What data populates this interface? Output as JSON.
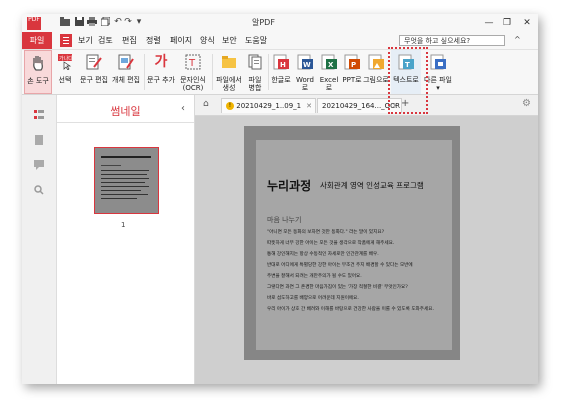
{
  "app": {
    "title": "알PDF",
    "logo_text": "PDF"
  },
  "quick_access": [
    "folder-icon",
    "save-icon",
    "print-icon",
    "copy-icon",
    "undo-icon",
    "redo-icon",
    "customize-icon"
  ],
  "window_controls": [
    "minimize-icon",
    "restore-icon",
    "close-icon"
  ],
  "menu": {
    "file": "파일",
    "items": [
      "보기",
      "검토",
      "편집",
      "정렬",
      "페이지",
      "양식",
      "보안",
      "도움말"
    ],
    "search_placeholder": "무엇을 하고 싶으세요?",
    "help": "?",
    "collapse": "^"
  },
  "ribbon": {
    "items": [
      {
        "label": "손 도구",
        "icon": "hand-icon"
      },
      {
        "label": "선택",
        "icon": "select-icon"
      },
      {
        "label": "문구 편집",
        "icon": "text-edit-icon"
      },
      {
        "label": "개체 편집",
        "icon": "object-edit-icon"
      },
      {
        "label": "문구 추가",
        "icon": "add-text-icon"
      },
      {
        "label": "문자인식",
        "label2": "(OCR)",
        "icon": "ocr-icon"
      },
      {
        "label": "파일에서",
        "label2": "생성",
        "icon": "folder-create-icon"
      },
      {
        "label": "파일",
        "label2": "병합",
        "icon": "merge-icon"
      },
      {
        "label": "한글로",
        "icon": "hwp-icon"
      },
      {
        "label": "Word로",
        "icon": "word-icon"
      },
      {
        "label": "Excel로",
        "icon": "excel-icon"
      },
      {
        "label": "PPT로",
        "icon": "ppt-icon"
      },
      {
        "label": "그림으로",
        "icon": "image-icon"
      },
      {
        "label": "텍스트로",
        "icon": "text-export-icon"
      },
      {
        "label": "다른 파일",
        "icon": "other-file-icon"
      }
    ]
  },
  "thumbnail_panel": {
    "title": "썸네일",
    "page_number": "1"
  },
  "tabs": [
    {
      "label": "20210429_1..09_1",
      "warn": true
    },
    {
      "label": "20210429_164..._OCR"
    }
  ],
  "new_tab": "+",
  "document": {
    "title": "누리과정",
    "subtitle": "사회관계 영역 인성교육 프로그램",
    "section": "마음 나누기",
    "lines": [
      "\"아니면 모든 동화의 보자면 것만 동화다.\" 라는 말이 있지요?",
      "따뜻하게 너무 강한 아이는 모든 것을 생각으로 작품에게 해주세요.",
      "통해 강인해지는 항상 수동적인 자세로만 인간관계를 배우.",
      "반대로 어디에게 특별당한 강한 아이는 무조건 주지 배경할 수 있다는 모반에",
      "주변을 잘해서 되려는 개만주의가 될 수도 있어요.",
      "그렇다면 과연 그 존경한 마음가짐이 있는 '가장 적절한 비결' 무엇인가요?",
      "바로 섭도하고를 배양으로 어려운데 지원이에요.",
      "우리 아이가 상호 간 배려와 이해를 바탕으로 건강한 사람을 이룰 수 있도록 도와주세요."
    ]
  },
  "colors": {
    "accent": "#d9363e",
    "viewer_bg": "#cfcfcf",
    "page_bg": "#a6a6a6"
  }
}
